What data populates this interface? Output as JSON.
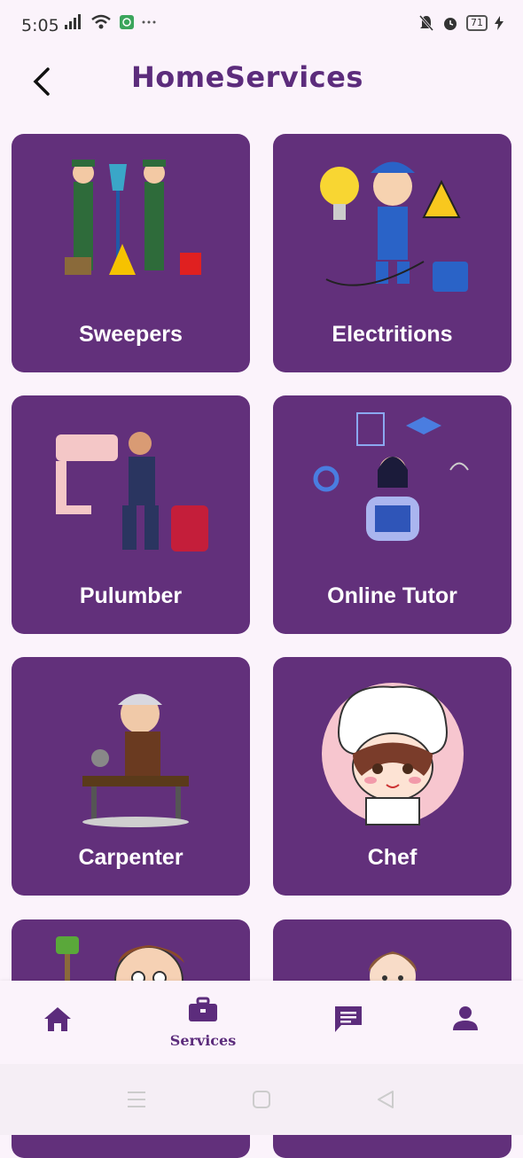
{
  "status_bar": {
    "time": "5:05",
    "battery": "71"
  },
  "header": {
    "title": "HomeServices"
  },
  "services": [
    {
      "label": "Sweepers",
      "icon": "sweepers-illustration"
    },
    {
      "label": "Electritions",
      "icon": "electrician-illustration"
    },
    {
      "label": "Pulumber",
      "icon": "plumber-illustration"
    },
    {
      "label": "Online Tutor",
      "icon": "tutor-illustration"
    },
    {
      "label": "Carpenter",
      "icon": "carpenter-illustration"
    },
    {
      "label": "Chef",
      "icon": "chef-illustration"
    },
    {
      "label": "",
      "icon": "painter-illustration"
    },
    {
      "label": "",
      "icon": "person-illustration"
    }
  ],
  "bottom_nav": {
    "items": [
      {
        "icon": "home-icon",
        "label": ""
      },
      {
        "icon": "briefcase-icon",
        "label": "Services"
      },
      {
        "icon": "chat-icon",
        "label": ""
      },
      {
        "icon": "person-icon",
        "label": ""
      }
    ],
    "active_color": "#5c2c7c"
  },
  "colors": {
    "card_bg": "#62307b",
    "page_bg": "#fbf3fb",
    "brand": "#5c2c7c"
  }
}
